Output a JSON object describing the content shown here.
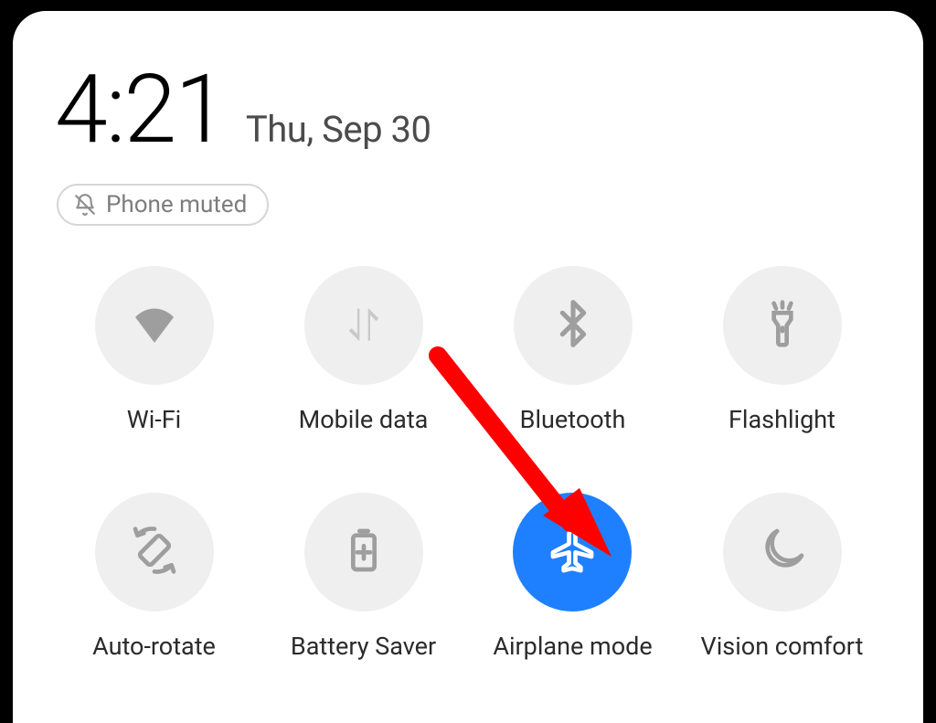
{
  "statusbar": {
    "time": "4:21",
    "date": "Thu, Sep 30"
  },
  "mute_chip": {
    "label": "Phone muted"
  },
  "tiles": {
    "wifi": {
      "label": "Wi-Fi"
    },
    "mobile_data": {
      "label": "Mobile data"
    },
    "bluetooth": {
      "label": "Bluetooth"
    },
    "flashlight": {
      "label": "Flashlight"
    },
    "auto_rotate": {
      "label": "Auto-rotate"
    },
    "battery_saver": {
      "label": "Battery Saver"
    },
    "airplane": {
      "label": "Airplane mode"
    },
    "vision": {
      "label": "Vision comfort"
    }
  },
  "colors": {
    "active_bg": "#1f80ff",
    "tile_bg": "#efefef",
    "icon": "#9e9e9e",
    "icon_dim": "#c9c9c9",
    "arrow": "#ff0000"
  }
}
